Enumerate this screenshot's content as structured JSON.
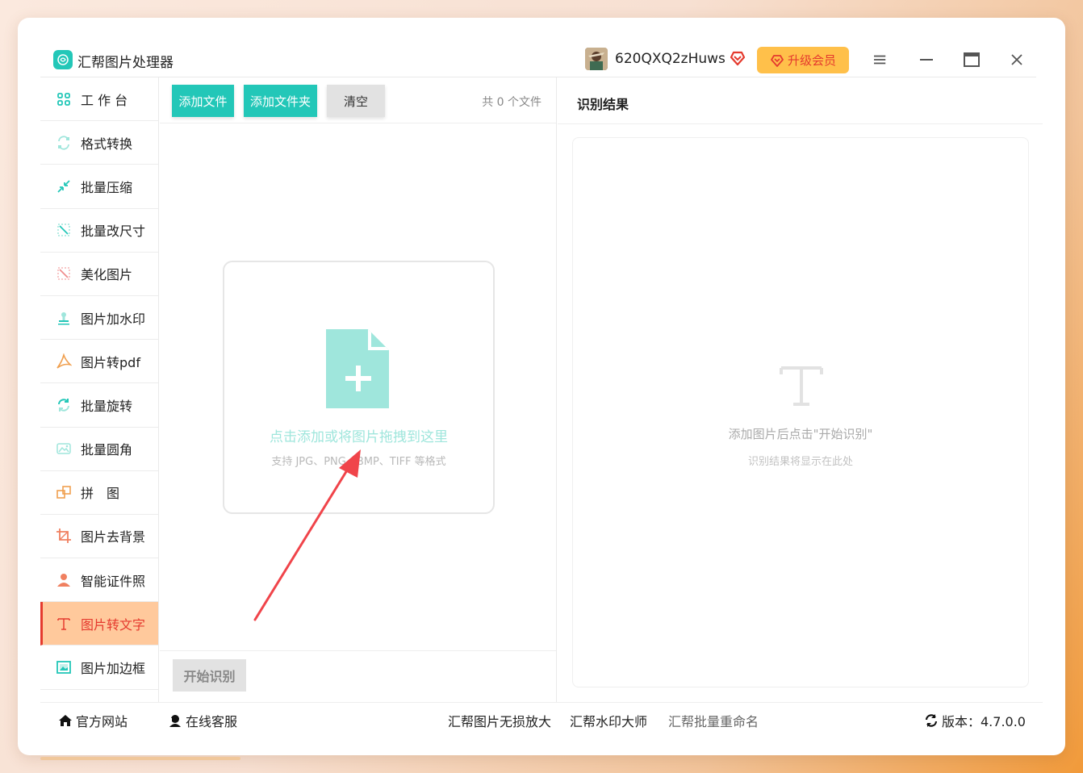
{
  "app": {
    "title": "汇帮图片处理器",
    "username": "620QXQ2zHuws",
    "upgrade_label": "升级会员"
  },
  "window_controls": {
    "menu_icon": "hamburger-icon",
    "minimize_icon": "minimize-icon",
    "maximize_icon": "maximize-icon",
    "close_icon": "close-icon"
  },
  "sidebar": {
    "items": [
      {
        "label": "工 作 台",
        "icon": "grid-icon"
      },
      {
        "label": "格式转换",
        "icon": "convert-icon"
      },
      {
        "label": "批量压缩",
        "icon": "compress-icon"
      },
      {
        "label": "批量改尺寸",
        "icon": "resize-icon"
      },
      {
        "label": "美化图片",
        "icon": "beautify-icon"
      },
      {
        "label": "图片加水印",
        "icon": "watermark-icon"
      },
      {
        "label": "图片转pdf",
        "icon": "pdf-icon"
      },
      {
        "label": "批量旋转",
        "icon": "rotate-icon"
      },
      {
        "label": "批量圆角",
        "icon": "round-corner-icon"
      },
      {
        "label": "拼　图",
        "icon": "collage-icon"
      },
      {
        "label": "图片去背景",
        "icon": "crop-icon"
      },
      {
        "label": "智能证件照",
        "icon": "person-icon"
      },
      {
        "label": "图片转文字",
        "icon": "text-icon",
        "active": true
      },
      {
        "label": "图片加边框",
        "icon": "frame-icon"
      }
    ]
  },
  "toolbar": {
    "add_file": "添加文件",
    "add_folder": "添加文件夹",
    "clear": "清空",
    "file_count": "共 0 个文件"
  },
  "dropzone": {
    "main_text": "点击添加或将图片拖拽到这里",
    "sub_text": "支持 JPG、PNG、BMP、TIFF 等格式"
  },
  "actions": {
    "start": "开始识别"
  },
  "result": {
    "title": "识别结果",
    "placeholder_main": "添加图片后点击\"开始识别\"",
    "placeholder_sub": "识别结果将显示在此处"
  },
  "footer": {
    "website": "官方网站",
    "support": "在线客服",
    "link1": "汇帮图片无损放大",
    "link2": "汇帮水印大师",
    "link3": "汇帮批量重命名",
    "version": "版本：4.7.0.0"
  },
  "colors": {
    "teal": "#23c7b8",
    "active_bg": "#ffc99c",
    "active_text": "#e53a2e",
    "upgrade_bg": "#ffc04a",
    "arrow": "#f0444a"
  }
}
